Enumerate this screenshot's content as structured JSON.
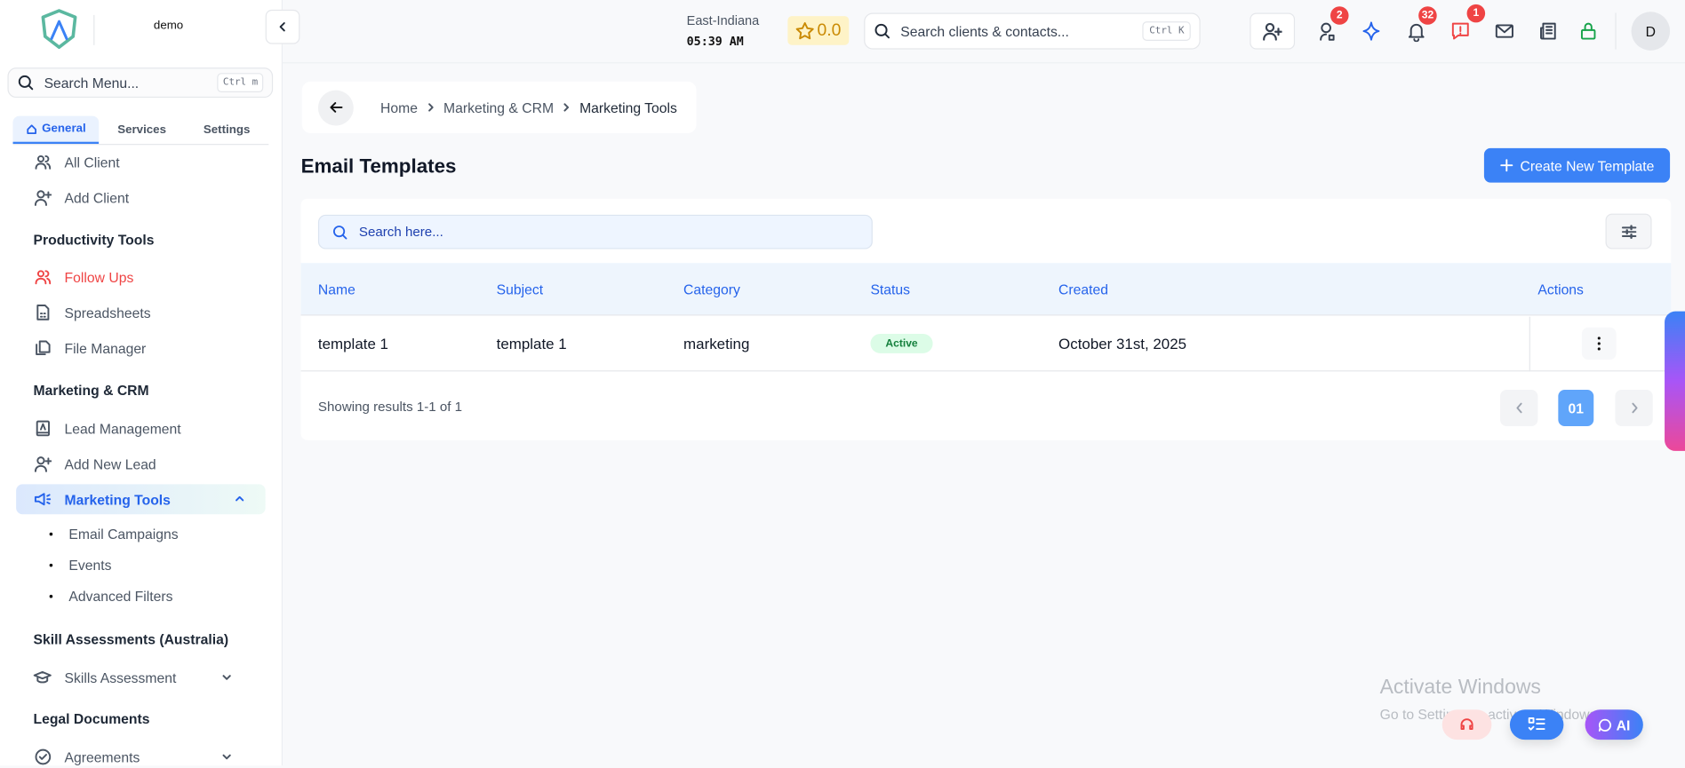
{
  "sidebar": {
    "brand": "demo",
    "search_placeholder": "Search Menu...",
    "search_shortcut": "Ctrl m",
    "tabs": [
      {
        "label": "General"
      },
      {
        "label": "Services"
      },
      {
        "label": "Settings"
      }
    ],
    "items": {
      "all_client": "All Client",
      "add_client": "Add Client",
      "productivity": "Productivity Tools",
      "follow_ups": "Follow Ups",
      "spreadsheets": "Spreadsheets",
      "file_manager": "File Manager",
      "marketing_crm": "Marketing & CRM",
      "lead_management": "Lead Management",
      "add_new_lead": "Add New Lead",
      "marketing_tools": "Marketing Tools",
      "email_campaigns": "Email Campaigns",
      "events": "Events",
      "advanced_filters": "Advanced Filters",
      "skill_assessments": "Skill Assessments (Australia)",
      "skills_assessment": "Skills Assessment",
      "legal_documents": "Legal Documents",
      "agreements": "Agreements"
    }
  },
  "topbar": {
    "timezone": "East-Indiana",
    "time": "05:39 AM",
    "rating": "0.0",
    "search_placeholder": "Search clients & contacts...",
    "search_shortcut": "Ctrl K",
    "badges": {
      "contacts": "2",
      "notifications": "32",
      "messages": "1"
    },
    "avatar": "D"
  },
  "breadcrumb": [
    "Home",
    "Marketing & CRM",
    "Marketing Tools"
  ],
  "page": {
    "title": "Email Templates",
    "create_button": "Create New Template",
    "search_placeholder": "Search here..."
  },
  "table": {
    "columns": [
      "Name",
      "Subject",
      "Category",
      "Status",
      "Created",
      "Actions"
    ],
    "rows": [
      {
        "name": "template 1",
        "subject": "template 1",
        "category": "marketing",
        "status": "Active",
        "created": "October 31st, 2025"
      }
    ],
    "summary": "Showing results 1-1 of 1",
    "current_page": "01"
  },
  "watermark": {
    "title": "Activate Windows",
    "subtitle": "Go to Settings to activate Windows."
  },
  "fab": {
    "ai_label": "AI"
  },
  "colors": {
    "accent": "#3b82f6",
    "danger": "#ef4444",
    "success": "#16a34a"
  }
}
